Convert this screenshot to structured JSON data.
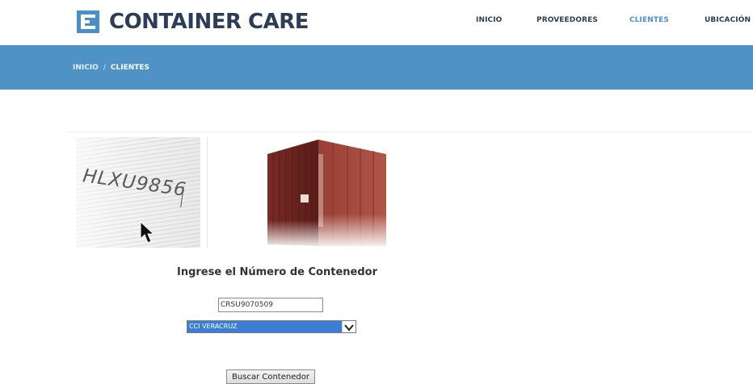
{
  "brand": {
    "name": "CONTAINER CARE",
    "accent": "#4a90c8",
    "dark": "#2c3e57"
  },
  "nav": [
    {
      "label": "INICIO"
    },
    {
      "label": "PROVEEDORES"
    },
    {
      "label": "CLIENTES",
      "active": true
    },
    {
      "label": "UBICACIÓN"
    }
  ],
  "breadcrumb": {
    "home": "INICIO",
    "separator": "/",
    "current": "CLIENTES"
  },
  "hero": {
    "container_code": "HLXU9856"
  },
  "form": {
    "heading": "Ingrese el Número de Contenedor",
    "container_number": "CRSU9070509",
    "terminal": "CCI VERACRUZ",
    "submit_label": "Buscar Contenedor"
  }
}
